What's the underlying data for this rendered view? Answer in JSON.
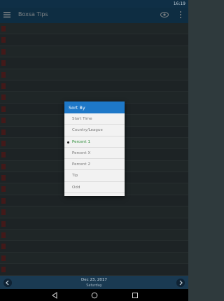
{
  "status_bar": {
    "time": "16:19"
  },
  "app_bar": {
    "title": "Boxsa Tips"
  },
  "sort_dialog": {
    "title": "Sort By",
    "options": [
      "Start Time",
      "Country/League",
      "Percent 1",
      "Percent X",
      "Percent 2",
      "Tip",
      "Odd"
    ],
    "selected_index": 2
  },
  "bottom_bar": {
    "date": "Dec 23, 2017",
    "day": "Saturday"
  },
  "colors": {
    "app_bar": "#1b5379",
    "dialog_header": "#1e78c8",
    "selected_option": "#2f8f3a"
  }
}
